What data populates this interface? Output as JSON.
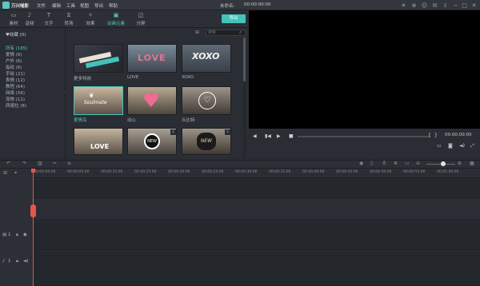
{
  "app": {
    "name": "万兴喵影",
    "project_title": "未命名:",
    "timecode_top": "00:00:00:00"
  },
  "menu": [
    "文件",
    "编辑",
    "工具",
    "视图",
    "导出",
    "帮助"
  ],
  "tabs": [
    {
      "label": "素材",
      "icon": "folder-icon"
    },
    {
      "label": "音频",
      "icon": "music-icon"
    },
    {
      "label": "文字",
      "icon": "text-icon"
    },
    {
      "label": "转场",
      "icon": "transition-icon"
    },
    {
      "label": "效果",
      "icon": "effects-icon"
    },
    {
      "label": "动画元素",
      "icon": "elements-icon",
      "active": true
    },
    {
      "label": "分屏",
      "icon": "split-screen-icon"
    }
  ],
  "export_label": "导出",
  "sidebar": {
    "favorites": "♥收藏 (0)",
    "categories": [
      {
        "label": "所有 (185)",
        "active": true
      },
      {
        "label": "爱情 (6)"
      },
      {
        "label": "户外 (6)"
      },
      {
        "label": "指纹 (6)"
      },
      {
        "label": "手绘 (21)"
      },
      {
        "label": "表情 (12)"
      },
      {
        "label": "教程 (64)"
      },
      {
        "label": "网络 (56)"
      },
      {
        "label": "宠物 (11)"
      },
      {
        "label": "西德拉 (8)"
      }
    ]
  },
  "search": {
    "placeholder": "搜索"
  },
  "thumbnails": [
    {
      "caption": "更多特效",
      "text": "FILMORA EFFECTS STORE"
    },
    {
      "caption": "LOVE",
      "text": "LOVE"
    },
    {
      "caption": "XOXO",
      "text": "XOXO"
    },
    {
      "caption": "爱情鸟",
      "text": "Soulmate",
      "selected": true
    },
    {
      "caption": "动心",
      "text": ""
    },
    {
      "caption": "丘比特",
      "text": ""
    },
    {
      "caption": "",
      "text": "LOVE"
    },
    {
      "caption": "",
      "text": "NEW"
    },
    {
      "caption": "",
      "text": "NEW"
    }
  ],
  "preview": {
    "timecode": "00:00:00:00",
    "bracket_in": "{",
    "bracket_out": "}"
  },
  "ruler": [
    "00:00:00:00",
    "00:00:05:00",
    "00:00:10:00",
    "00:00:15:00",
    "00:00:20:00",
    "00:00:25:00",
    "00:00:30:00",
    "00:00:35:00",
    "00:00:40:00",
    "00:00:45:00",
    "00:00:50:00",
    "00:00:55:00",
    "00:01:00:00",
    "00:01:05:00"
  ],
  "tracks": {
    "video_label": "1",
    "audio_label": "1"
  }
}
